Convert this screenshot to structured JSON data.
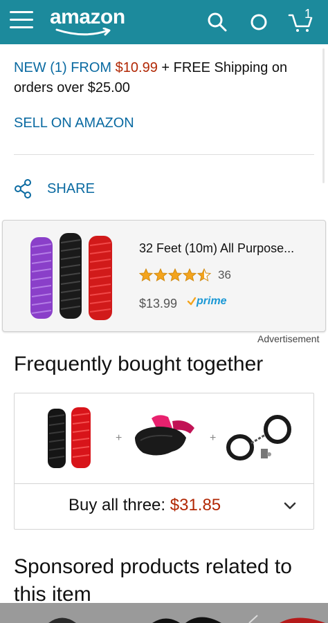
{
  "header": {
    "logo": "amazon",
    "cart_count": "1",
    "bg_color": "#1c8a9c",
    "icons": [
      "menu-icon",
      "search-icon",
      "alexa-icon",
      "cart-icon"
    ]
  },
  "offer": {
    "prefix": "NEW (1) FROM ",
    "price": "$10.99",
    "suffix": " + FREE Shipping on orders over $25.00"
  },
  "sell_link": "SELL ON AMAZON",
  "share_label": "SHARE",
  "ad": {
    "title": "32 Feet (10m) All Purpose...",
    "rating": 4.5,
    "rating_count": "36",
    "price": "$13.99",
    "prime": "prime",
    "label": "Advertisement"
  },
  "fbt": {
    "title": "Frequently bought together",
    "buy_label": "Buy all three: ",
    "total": "$31.85",
    "plus": "+"
  },
  "sponsored_title": "Sponsored products related to this item",
  "colors": {
    "link": "#0a6aa1",
    "price": "#b12704",
    "prime": "#1a98d5",
    "star": "#f4a41d"
  }
}
